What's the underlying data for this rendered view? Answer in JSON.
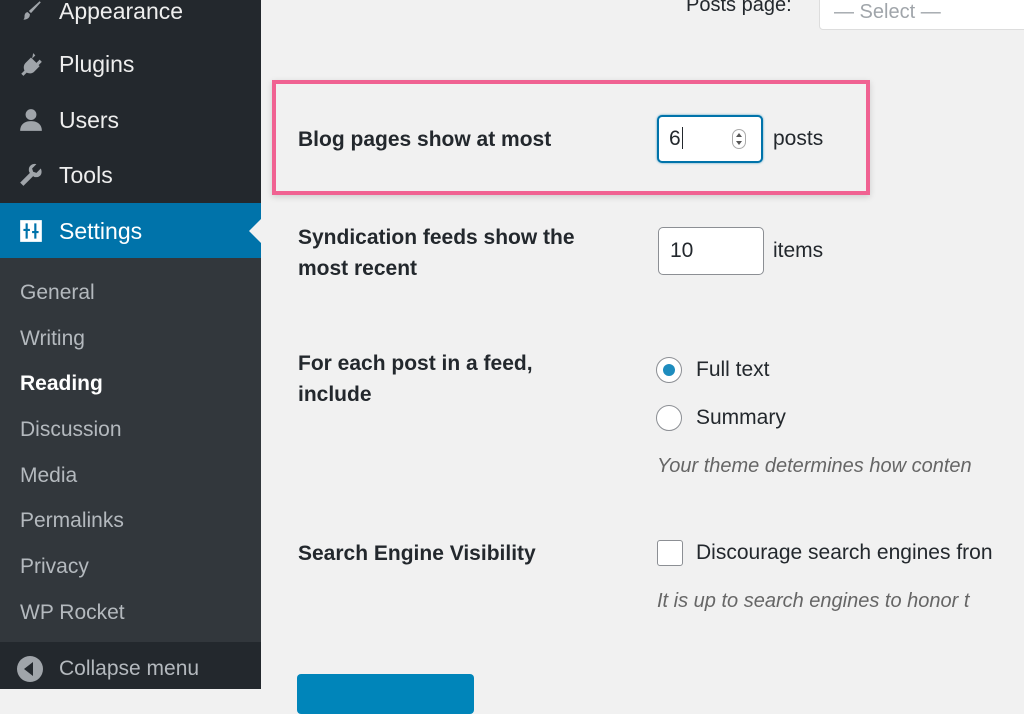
{
  "sidebar": {
    "menu": [
      {
        "label": "Appearance",
        "icon": "paintbrush-icon"
      },
      {
        "label": "Plugins",
        "icon": "plug-icon"
      },
      {
        "label": "Users",
        "icon": "user-icon"
      },
      {
        "label": "Tools",
        "icon": "wrench-icon"
      },
      {
        "label": "Settings",
        "icon": "sliders-icon",
        "active": true
      }
    ],
    "submenu": [
      "General",
      "Writing",
      "Reading",
      "Discussion",
      "Media",
      "Permalinks",
      "Privacy",
      "WP Rocket"
    ],
    "current_submenu": "Reading",
    "collapse_label": "Collapse menu"
  },
  "reading": {
    "posts_page_label": "Posts page:",
    "posts_page_select": "— Select —",
    "blog_pages_label": "Blog pages show at most",
    "blog_pages_value": "6",
    "blog_pages_unit": "posts",
    "syndication_label_line1": "Syndication feeds show the",
    "syndication_label_line2": "most recent",
    "syndication_value": "10",
    "syndication_unit": "items",
    "feed_label_line1": "For each post in a feed,",
    "feed_label_line2": "include",
    "feed_options": [
      "Full text",
      "Summary"
    ],
    "feed_selected": "Full text",
    "feed_desc": "Your theme determines how conten",
    "sev_label": "Search Engine Visibility",
    "sev_checkbox_label": "Discourage search engines fron",
    "sev_checked": false,
    "sev_desc": "It is up to search engines to honor t"
  },
  "colors": {
    "sidebar_bg": "#23282d",
    "submenu_bg": "#32373c",
    "active_bg": "#0073aa",
    "highlight": "#f06292"
  }
}
